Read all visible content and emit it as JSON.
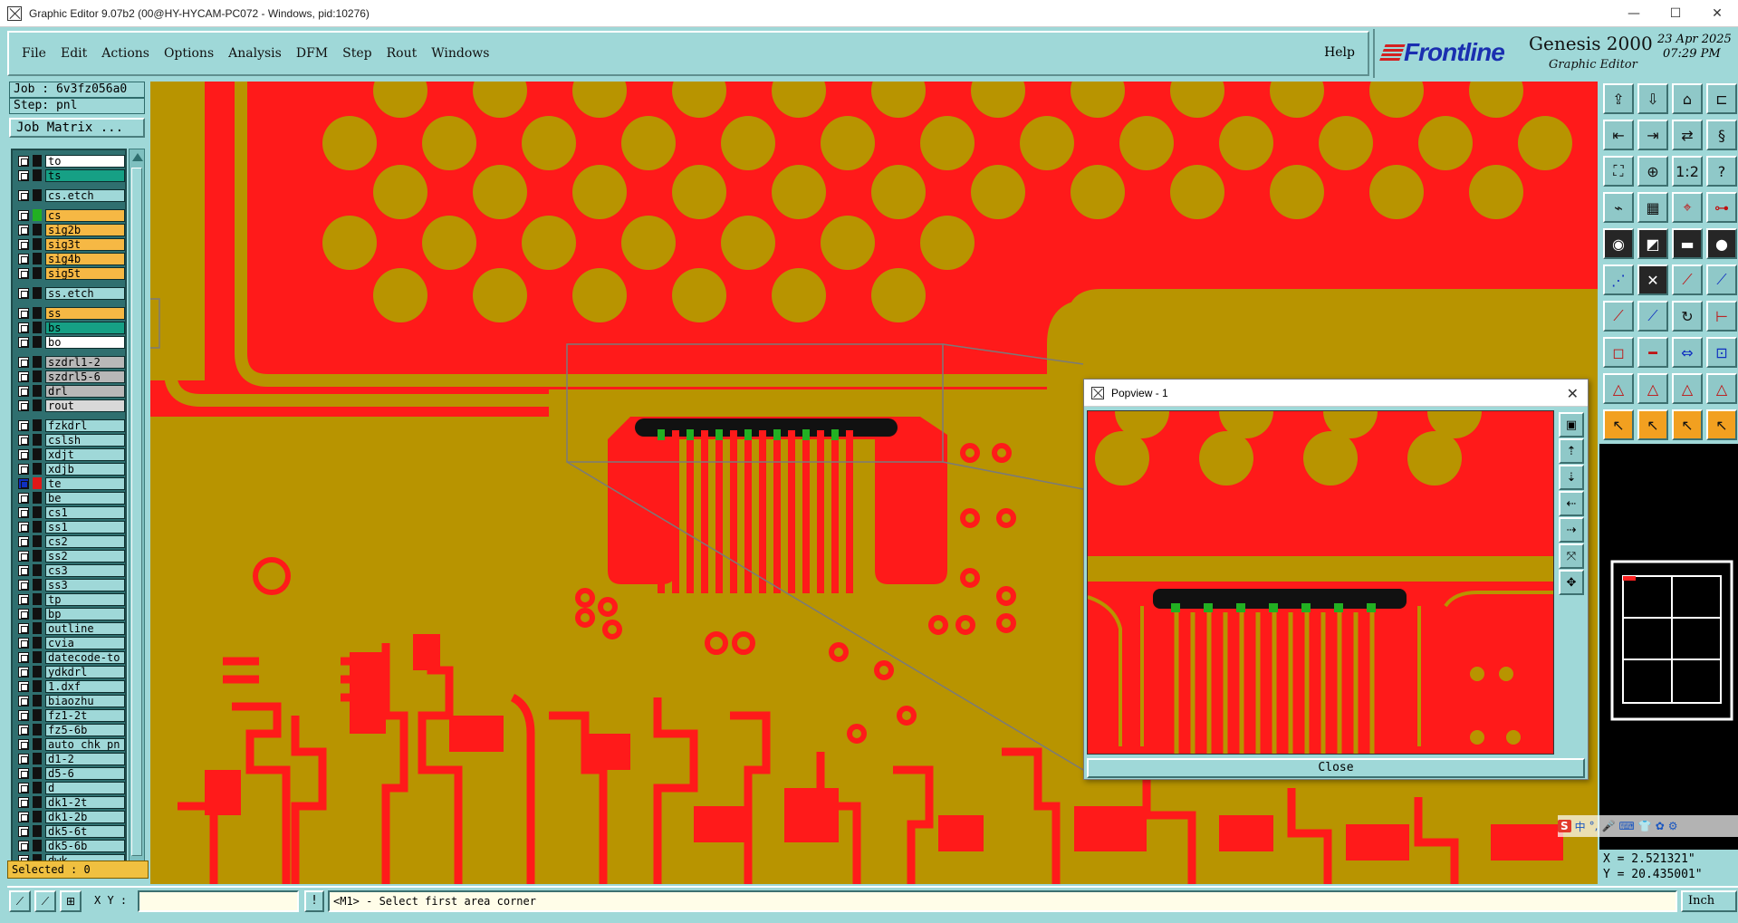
{
  "window": {
    "title": "Graphic Editor 9.07b2 (00@HY-HYCAM-PC072 - Windows, pid:10276)",
    "minimize": "—",
    "maximize": "☐",
    "close": "✕"
  },
  "menu": {
    "items": [
      "File",
      "Edit",
      "Actions",
      "Options",
      "Analysis",
      "DFM",
      "Step",
      "Rout",
      "Windows"
    ],
    "help": "Help"
  },
  "brand": {
    "logo": "Frontline",
    "product": "Genesis 2000",
    "subtitle": "Graphic Editor",
    "date": "23 Apr 2025",
    "time": "07:29 PM"
  },
  "job": {
    "job_line": "Job : 6v3fz056a0",
    "step_line": "Step: pnl",
    "matrix_button": "Job Matrix ..."
  },
  "layers": [
    {
      "name": "to",
      "color": "#ffffff"
    },
    {
      "name": "ts",
      "color": "#16a085"
    },
    {
      "name": "cs.etch",
      "color": "#9fd8d8"
    },
    {
      "name": "cs",
      "color": "#f6b844",
      "swatch": "#22b022"
    },
    {
      "name": "sig2b",
      "color": "#f6b844"
    },
    {
      "name": "sig3t",
      "color": "#f6b844"
    },
    {
      "name": "sig4b",
      "color": "#f6b844"
    },
    {
      "name": "sig5t",
      "color": "#f6b844"
    },
    {
      "name": "ss.etch",
      "color": "#9fd8d8"
    },
    {
      "name": "ss",
      "color": "#f6b844"
    },
    {
      "name": "bs",
      "color": "#16a085"
    },
    {
      "name": "bo",
      "color": "#ffffff"
    },
    {
      "name": "szdrl1-2",
      "color": "#b8b8b8"
    },
    {
      "name": "szdrl5-6",
      "color": "#b8b8b8"
    },
    {
      "name": "drl",
      "color": "#b8b8b8"
    },
    {
      "name": "rout",
      "color": "#d8d8d8"
    },
    {
      "name": "fzkdrl",
      "color": "#9fd8d8"
    },
    {
      "name": "cslsh",
      "color": "#9fd8d8"
    },
    {
      "name": "xdjt",
      "color": "#9fd8d8"
    },
    {
      "name": "xdjb",
      "color": "#9fd8d8"
    },
    {
      "name": "te",
      "color": "#9fd8d8",
      "swatch": "#e01818",
      "active": true
    },
    {
      "name": "be",
      "color": "#9fd8d8"
    },
    {
      "name": "cs1",
      "color": "#9fd8d8"
    },
    {
      "name": "ss1",
      "color": "#9fd8d8"
    },
    {
      "name": "cs2",
      "color": "#9fd8d8"
    },
    {
      "name": "ss2",
      "color": "#9fd8d8"
    },
    {
      "name": "cs3",
      "color": "#9fd8d8"
    },
    {
      "name": "ss3",
      "color": "#9fd8d8"
    },
    {
      "name": "tp",
      "color": "#9fd8d8"
    },
    {
      "name": "bp",
      "color": "#9fd8d8"
    },
    {
      "name": "outline",
      "color": "#9fd8d8"
    },
    {
      "name": "cvia",
      "color": "#9fd8d8"
    },
    {
      "name": "datecode-to",
      "color": "#9fd8d8"
    },
    {
      "name": "ydkdrl",
      "color": "#9fd8d8"
    },
    {
      "name": "1.dxf",
      "color": "#9fd8d8"
    },
    {
      "name": "biaozhu",
      "color": "#9fd8d8"
    },
    {
      "name": "fz1-2t",
      "color": "#9fd8d8"
    },
    {
      "name": "fz5-6b",
      "color": "#9fd8d8"
    },
    {
      "name": "auto_chk_pn",
      "color": "#9fd8d8"
    },
    {
      "name": "d1-2",
      "color": "#9fd8d8"
    },
    {
      "name": "d5-6",
      "color": "#9fd8d8"
    },
    {
      "name": "d",
      "color": "#9fd8d8"
    },
    {
      "name": "dk1-2t",
      "color": "#9fd8d8"
    },
    {
      "name": "dk1-2b",
      "color": "#9fd8d8"
    },
    {
      "name": "dk5-6t",
      "color": "#9fd8d8"
    },
    {
      "name": "dk5-6b",
      "color": "#9fd8d8"
    },
    {
      "name": "dwk",
      "color": "#9fd8d8"
    }
  ],
  "selected": "Selected : 0",
  "status": {
    "xy_label": "X Y :",
    "xy_value": "",
    "excl": "!",
    "prompt": "<M1> - Select first area corner",
    "units": "Inch"
  },
  "coords": {
    "x": "X = 2.521321\"",
    "y": "Y = 20.435001\""
  },
  "popview": {
    "title": "Popview - 1",
    "close_button": "Close",
    "close_x": "✕"
  },
  "colors": {
    "copper": "#ff1a1a",
    "substrate": "#b89400",
    "panel": "#9fd8d8",
    "gold": "#f6b844"
  },
  "ime": {
    "logo": "S",
    "items": [
      "中",
      "°,",
      "🎤",
      "⌨",
      "👕",
      "✿",
      "⚙"
    ]
  }
}
